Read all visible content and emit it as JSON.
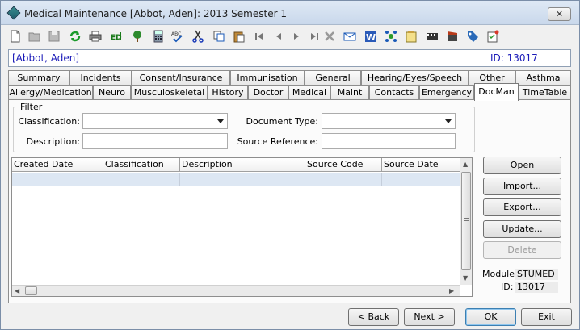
{
  "window": {
    "title": "Medical Maintenance   [Abbot, Aden]: 2013 Semester 1",
    "close_label": "✕"
  },
  "toolbar": {
    "buttons": [
      {
        "name": "new-document-icon",
        "glyph": "🗋"
      },
      {
        "name": "open-folder-icon",
        "glyph": "📂"
      },
      {
        "name": "save-icon",
        "glyph": "💾"
      },
      {
        "name": "refresh-icon",
        "glyph": "⟳"
      },
      {
        "name": "print-icon",
        "glyph": "🖶"
      },
      {
        "name": "edit-icon",
        "glyph": "ED"
      },
      {
        "name": "tree-icon",
        "glyph": "🌳"
      },
      {
        "name": "calculator-icon",
        "glyph": "🖩"
      },
      {
        "name": "spell-check-icon",
        "glyph": "ABC"
      },
      {
        "name": "cut-icon",
        "glyph": "✂"
      },
      {
        "name": "copy-icon",
        "glyph": "⎘"
      },
      {
        "name": "paste-icon",
        "glyph": "📋"
      },
      {
        "name": "first-record-icon",
        "glyph": "⏮"
      },
      {
        "name": "previous-record-icon",
        "glyph": "◀"
      },
      {
        "name": "next-record-icon",
        "glyph": "▶"
      },
      {
        "name": "last-record-icon",
        "glyph": "⏭"
      },
      {
        "name": "delete-icon",
        "glyph": "✖"
      },
      {
        "name": "email-icon",
        "glyph": "✉"
      },
      {
        "name": "word-icon",
        "glyph": "W"
      },
      {
        "name": "network-icon",
        "glyph": "✤"
      },
      {
        "name": "notes-icon",
        "glyph": "📝"
      },
      {
        "name": "film-icon",
        "glyph": "🎞"
      },
      {
        "name": "record-icon",
        "glyph": "🎬"
      },
      {
        "name": "tag-icon",
        "glyph": "🏷"
      },
      {
        "name": "checklist-icon",
        "glyph": "☑"
      }
    ]
  },
  "header": {
    "student_name": "[Abbot, Aden]",
    "student_id": "ID: 13017"
  },
  "tabs_row1": [
    {
      "label": "Summary"
    },
    {
      "label": "Incidents"
    },
    {
      "label": "Consent/Insurance"
    },
    {
      "label": "Immunisation"
    },
    {
      "label": "General"
    },
    {
      "label": "Hearing/Eyes/Speech"
    },
    {
      "label": "Other"
    },
    {
      "label": "Asthma"
    }
  ],
  "tabs_row2": [
    {
      "label": "Allergy/Medication"
    },
    {
      "label": "Neuro"
    },
    {
      "label": "Musculoskeletal"
    },
    {
      "label": "History"
    },
    {
      "label": "Doctor"
    },
    {
      "label": "Medical"
    },
    {
      "label": "Maint"
    },
    {
      "label": "Contacts"
    },
    {
      "label": "Emergency"
    },
    {
      "label": "DocMan"
    },
    {
      "label": "TimeTable"
    }
  ],
  "filter": {
    "legend": "Filter",
    "classification_label": "Classification:",
    "classification_value": "",
    "document_type_label": "Document Type:",
    "document_type_value": "",
    "description_label": "Description:",
    "description_value": "",
    "source_reference_label": "Source Reference:",
    "source_reference_value": ""
  },
  "grid": {
    "columns": [
      "Created Date",
      "Classification",
      "Description",
      "Source Code",
      "Source Date"
    ]
  },
  "side_buttons": {
    "open": "Open",
    "import": "Import...",
    "export": "Export...",
    "update": "Update...",
    "delete": "Delete"
  },
  "info": {
    "module_label": "Module:",
    "module_value": "STUMED",
    "id_label": "ID:",
    "id_value": "13017"
  },
  "footer": {
    "back": "< Back",
    "next": "Next >",
    "ok": "OK",
    "exit": "Exit"
  },
  "colors": {
    "header_text": "#1a1ab8",
    "selected_row": "#dde7f3"
  }
}
